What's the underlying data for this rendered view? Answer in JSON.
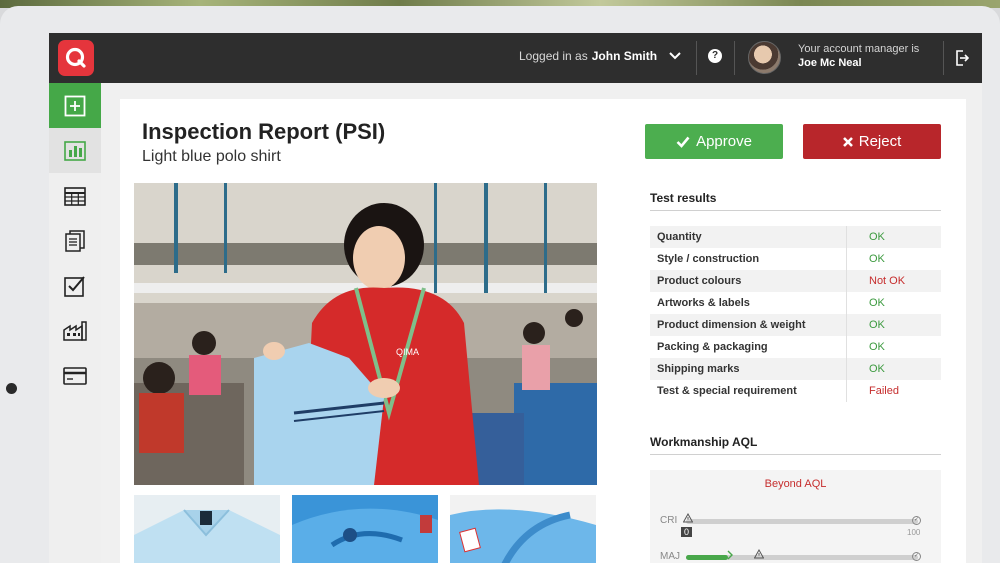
{
  "header": {
    "logged_in_prefix": "Logged in as",
    "user_name": "John Smith",
    "account_manager_label": "Your account manager is",
    "account_manager_name": "Joe Mc Neal"
  },
  "sidebar": {
    "items": [
      {
        "icon": "plus-square-icon"
      },
      {
        "icon": "bar-chart-icon"
      },
      {
        "icon": "calendar-icon"
      },
      {
        "icon": "documents-icon"
      },
      {
        "icon": "checkbox-icon"
      },
      {
        "icon": "factory-icon"
      },
      {
        "icon": "credit-card-icon"
      }
    ]
  },
  "report": {
    "title": "Inspection Report (PSI)",
    "subtitle": "Light blue polo shirt",
    "approve_label": "Approve",
    "reject_label": "Reject",
    "shirt_logo_text": "QIMA"
  },
  "test_results": {
    "heading": "Test results",
    "rows": [
      {
        "label": "Quantity",
        "value": "OK",
        "status": "ok"
      },
      {
        "label": "Style / construction",
        "value": "OK",
        "status": "ok"
      },
      {
        "label": "Product colours",
        "value": "Not OK",
        "status": "bad"
      },
      {
        "label": "Artworks & labels",
        "value": "OK",
        "status": "ok"
      },
      {
        "label": "Product dimension & weight",
        "value": "OK",
        "status": "ok"
      },
      {
        "label": "Packing & packaging",
        "value": "OK",
        "status": "ok"
      },
      {
        "label": "Shipping marks",
        "value": "OK",
        "status": "ok"
      },
      {
        "label": "Test & special requirement",
        "value": "Failed",
        "status": "bad"
      }
    ]
  },
  "workmanship": {
    "heading": "Workmanship AQL",
    "status": "Beyond AQL",
    "cri": {
      "label": "CRI",
      "count": "0",
      "max": "100",
      "fraction": 0.0
    },
    "maj": {
      "label": "MAJ",
      "fraction": 0.18
    }
  },
  "colors": {
    "approve": "#4cae4f",
    "reject": "#b8262b",
    "ok": "#3c9a3f",
    "bad": "#c62d2d",
    "brand": "#e5353c",
    "topbar": "#2e2e2e"
  }
}
